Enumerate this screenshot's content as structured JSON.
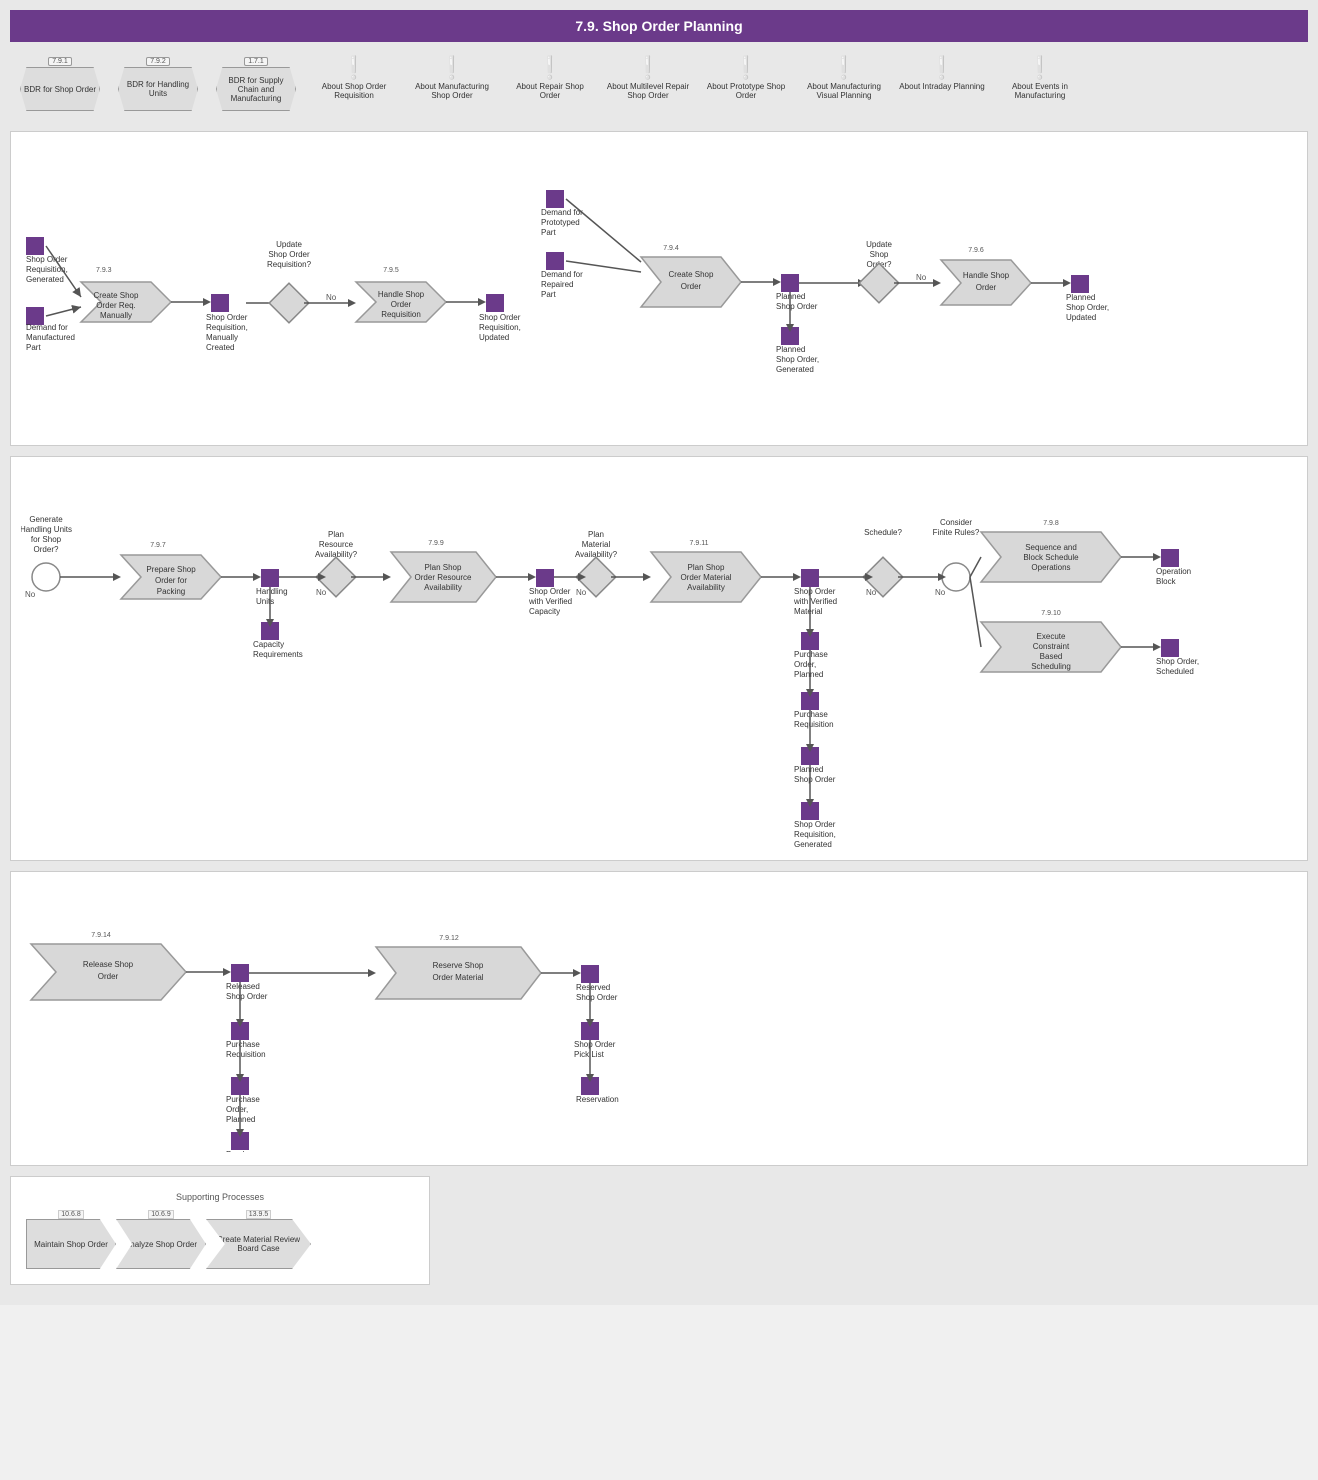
{
  "title": "7.9. Shop Order Planning",
  "top_items": [
    {
      "type": "hexagon",
      "version": "7.9.1",
      "label": "BDR for Shop Order"
    },
    {
      "type": "hexagon",
      "version": "7.9.2",
      "label": "BDR for Handling Units"
    },
    {
      "type": "hexagon",
      "version": "1.7.1",
      "label": "BDR for Supply Chain and Manufacturing"
    },
    {
      "type": "exclaim",
      "label": "About Shop Order Requisition"
    },
    {
      "type": "exclaim",
      "label": "About Manufacturing Shop Order"
    },
    {
      "type": "exclaim",
      "label": "About Repair Shop Order"
    },
    {
      "type": "exclaim",
      "label": "About Multilevel Repair Shop Order"
    },
    {
      "type": "exclaim",
      "label": "About Prototype Shop Order"
    },
    {
      "type": "exclaim",
      "label": "About Manufacturing Visual Planning"
    },
    {
      "type": "exclaim",
      "label": "About Intraday Planning"
    },
    {
      "type": "exclaim",
      "label": "About Events in Manufacturing"
    }
  ],
  "section1": {
    "inputs": [
      "Shop Order Requisition, Generated",
      "Demand for Manufactured Part"
    ],
    "process1_version": "7.9.3",
    "process1_label": "Create Shop Order Requisition Manually",
    "output1": "Shop Order Requisition, Manually Created",
    "gateway1_label": "Update Shop Order Requisition?",
    "gateway1_no": "No",
    "process2_version": "7.9.5",
    "process2_label": "Handle Shop Order Requisition",
    "output2": "Shop Order Requisition, Updated",
    "demands": [
      "Demand for Prototyped Part",
      "Demand for Repaired Part"
    ],
    "process3_version": "7.9.4",
    "process3_label": "Create Shop Order",
    "output3": "Planned Shop Order",
    "output3b": "Planned Shop Order, Generated",
    "gateway2_label": "Update Shop Order?",
    "gateway2_no": "No",
    "process4_version": "7.9.6",
    "process4_label": "Handle Shop Order",
    "output4": "Planned Shop Order, Updated"
  },
  "section2": {
    "gateway_label": "Generate Handling Units for Shop Order?",
    "gateway_no": "No",
    "process1_version": "7.9.7",
    "process1_label": "Prepare Shop Order for Packing",
    "output1": "Handling Units",
    "output1b": "Capacity Requirements",
    "gateway2_label": "Plan Resource Availability?",
    "gateway2_no": "No",
    "process2_version": "7.9.9",
    "process2_label": "Plan Shop Order Resource Availability",
    "output2": "Shop Order with Verified Capacity",
    "gateway3_label": "Plan Material Availability?",
    "gateway3_no": "No",
    "process3_version": "7.9.11",
    "process3_label": "Plan Shop Order Material Availability",
    "output3": "Shop Order with Verified Material",
    "output3b": "Purchase Order, Planned",
    "output3c": "Purchase Requisition",
    "output3d": "Planned Shop Order",
    "output3e": "Shop Order Requisition, Generated",
    "gateway4_label": "Schedule?",
    "gateway4_no": "No",
    "gateway5_label": "Consider Finite Rules?",
    "gateway5_no": "No",
    "process4_version": "7.9.8",
    "process4_label": "Sequence and Block Schedule Operations",
    "output4": "Operation Block",
    "process5_version": "7.9.10",
    "process5_label": "Execute Constraint Based Scheduling",
    "output5": "Shop Order, Scheduled"
  },
  "section3": {
    "process1_version": "7.9.14",
    "process1_label": "Release Shop Order",
    "output1": "Released Shop Order",
    "output1b": "Purchase Requisition",
    "output1c": "Purchase Order, Planned",
    "output1d": "Purchase Order, Released",
    "process2_version": "7.9.12",
    "process2_label": "Reserve Shop Order Material",
    "output2": "Reserved Shop Order",
    "output2b": "Shop Order Pick List",
    "output2c": "Reservation"
  },
  "section4": {
    "title": "Supporting Processes",
    "items": [
      {
        "version": "10.6.8",
        "label": "Maintain Shop Order"
      },
      {
        "version": "10.6.9",
        "label": "Analyze Shop Order"
      },
      {
        "version": "13.9.5",
        "label": "Create Material Review Board Case"
      }
    ]
  }
}
